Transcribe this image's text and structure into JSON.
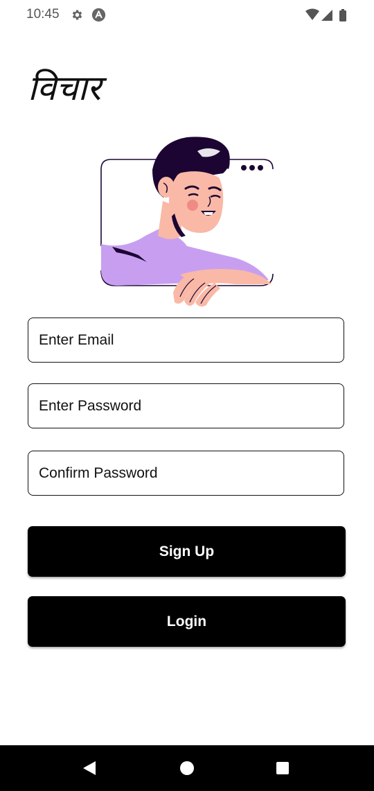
{
  "status_bar": {
    "time": "10:45",
    "icons": [
      "gear-icon",
      "a-icon",
      "wifi-icon",
      "signal-icon",
      "battery-icon"
    ]
  },
  "app": {
    "logo_text": "विचार"
  },
  "form": {
    "email": {
      "placeholder": "Enter Email",
      "value": ""
    },
    "password": {
      "placeholder": "Enter Password",
      "value": ""
    },
    "confirm_password": {
      "placeholder": "Confirm Password",
      "value": ""
    }
  },
  "buttons": {
    "signup_label": "Sign Up",
    "login_label": "Login"
  },
  "nav": {
    "icons": [
      "back-icon",
      "home-icon",
      "recents-icon"
    ]
  },
  "colors": {
    "background": "#ffffff",
    "button_bg": "#000000",
    "button_text": "#ffffff",
    "accent_purple": "#c89ff0",
    "skin": "#f9b9a6",
    "hair": "#1c0533"
  }
}
